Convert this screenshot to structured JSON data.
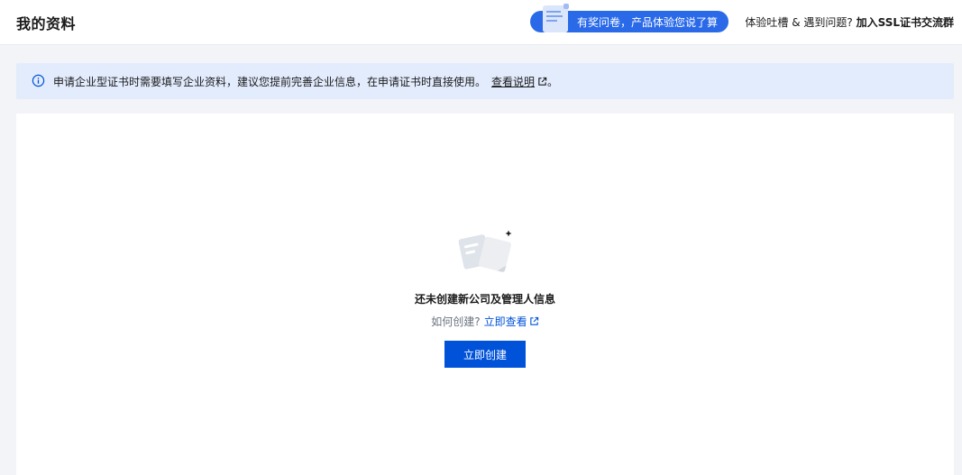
{
  "header": {
    "title": "我的资料",
    "survey_label": "有奖问卷，产品体验您说了算",
    "feedback_prefix": "体验吐槽 & 遇到问题?",
    "feedback_link": "加入SSL证书交流群"
  },
  "notice": {
    "text": "申请企业型证书时需要填写企业资料，建议您提前完善企业信息，在申请证书时直接使用。",
    "link_label": "查看说明",
    "suffix": "。"
  },
  "empty_state": {
    "title": "还未创建新公司及管理人信息",
    "how_prefix": "如何创建?",
    "how_link": "立即查看",
    "button_label": "立即创建"
  },
  "colors": {
    "primary": "#0052d9",
    "pill": "#2a6ae9",
    "notice_bg": "#e3ecfd",
    "page_bg": "#f3f4f7"
  }
}
